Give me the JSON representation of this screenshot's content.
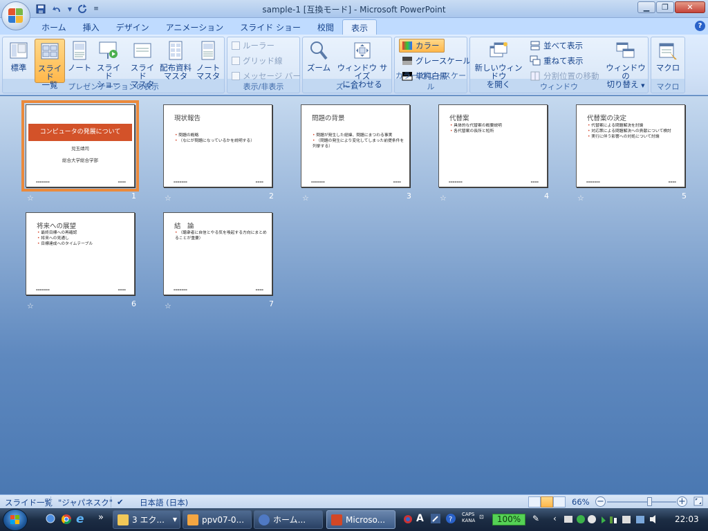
{
  "window": {
    "title": "sample-1 [互換モード] - Microsoft PowerPoint"
  },
  "tabs": [
    {
      "label": "ホーム"
    },
    {
      "label": "挿入"
    },
    {
      "label": "デザイン"
    },
    {
      "label": "アニメーション"
    },
    {
      "label": "スライド ショー"
    },
    {
      "label": "校閲"
    },
    {
      "label": "表示",
      "active": true
    }
  ],
  "ribbon": {
    "presentation_views": {
      "label": "プレゼンテーションの表示",
      "normal": "標準",
      "sorter_1": "スライド",
      "sorter_2": "一覧",
      "notes": "ノート",
      "show_1": "スライド",
      "show_2": "ショー",
      "slide_master_1": "スライド",
      "slide_master_2": "マスタ",
      "handout_master_1": "配布資料",
      "handout_master_2": "マスタ",
      "notes_master_1": "ノート",
      "notes_master_2": "マスタ"
    },
    "show_hide": {
      "label": "表示/非表示",
      "ruler": "ルーラー",
      "grid": "グリッド線",
      "message_bar": "メッセージ バー"
    },
    "zoom": {
      "label": "ズーム",
      "zoom": "ズーム",
      "fit_1": "ウィンドウ サイズ",
      "fit_2": "に合わせる"
    },
    "color": {
      "label": "カラー/グレースケール",
      "color": "カラー",
      "grayscale": "グレースケール",
      "bw": "単純白黒"
    },
    "window": {
      "label": "ウィンドウ",
      "new_1": "新しいウィンドウ",
      "new_2": "を開く",
      "arrange": "並べて表示",
      "cascade": "重ねて表示",
      "split": "分割位置の移動",
      "switch_1": "ウィンドウの",
      "switch_2": "切り替え"
    },
    "macro": {
      "label": "マクロ",
      "macro": "マクロ"
    }
  },
  "slides": [
    {
      "num": "1",
      "title": "コンピュータの発展について",
      "sub1": "児玉靖司",
      "sub2": "総合大学総合学部",
      "bullets": []
    },
    {
      "num": "2",
      "title": "現状報告",
      "bullets": [
        "問題の概略",
        "（なにが問題になっているかを説明する）"
      ]
    },
    {
      "num": "3",
      "title": "問題の背景",
      "bullets": [
        "問題が発生した経緯、問題にまつわる事実",
        "（問題の発生により変化してしまった前提条件を列挙する）"
      ]
    },
    {
      "num": "4",
      "title": "代替案",
      "bullets": [
        "具体的な代替案の概要説明",
        "各代替案の長所と短所"
      ]
    },
    {
      "num": "5",
      "title": "代替案の決定",
      "bullets": [
        "代替案による問題解決を討論",
        "対応策による問題解決への貢献について検討",
        "実行に伴う影響への対処について討論"
      ]
    },
    {
      "num": "6",
      "title": "将来への展望",
      "bullets": [
        "最終目標への再確認",
        "将来への見通し",
        "目標達成へのタイムテーブル"
      ]
    },
    {
      "num": "7",
      "title": "結　論",
      "bullets": [
        "（聴衆者に自信とやる気を喚起する方向にまとめることが重要）"
      ]
    }
  ],
  "status": {
    "view": "スライド一覧",
    "theme": "\"ジャパネスク\"",
    "language": "日本語 (日本)",
    "zoom": "66%"
  },
  "taskbar": {
    "tasks": [
      {
        "label": "3 エク..."
      },
      {
        "label": "ppv07-0..."
      },
      {
        "label": "ホーム..."
      },
      {
        "label": "Microso..."
      }
    ],
    "ime_zoom": "100%",
    "caps": "CAPS",
    "kana": "KANA",
    "clock": "22:03"
  },
  "colors": {
    "accent_orange": "#eb8a3c",
    "slide_title_band": "#d35229",
    "ribbon_bg": "#dbe8f8"
  }
}
